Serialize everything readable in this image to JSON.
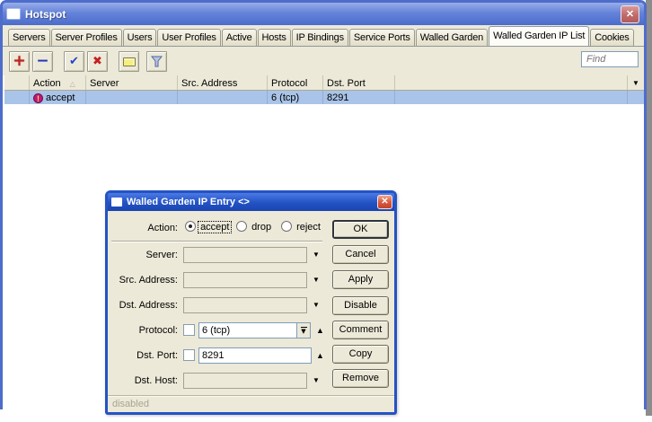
{
  "icons": {
    "close": "✕",
    "dropdown": "▼",
    "up_arrow": "▲",
    "sort_asc": "△",
    "plus": "+",
    "minus": "−",
    "check": "✔",
    "cross": "✖",
    "exclamation": "!"
  },
  "colors": {
    "titlebar_blue": "#5E7CD6",
    "dialog_blue": "#2453C4",
    "selection_blue": "#A9C4E8",
    "panel_tan": "#ECE9D8",
    "disabled_text": "#A8A490"
  },
  "window": {
    "title": "Hotspot",
    "tabs": [
      "Servers",
      "Server Profiles",
      "Users",
      "User Profiles",
      "Active",
      "Hosts",
      "IP Bindings",
      "Service Ports",
      "Walled Garden",
      "Walled Garden IP List",
      "Cookies"
    ],
    "active_tab": "Walled Garden IP List",
    "toolbar": {
      "find_placeholder": "Find"
    },
    "table": {
      "columns": [
        "Action",
        "Server",
        "Src. Address",
        "Protocol",
        "Dst. Port"
      ],
      "sort_column": "Action",
      "sort_direction": "ascending",
      "row": {
        "action": "accept",
        "server": "",
        "src_address": "",
        "protocol": "6 (tcp)",
        "dst_port": "8291",
        "state": "disabled"
      }
    }
  },
  "dialog": {
    "title": "Walled Garden IP Entry <>",
    "action_label": "Action:",
    "action_options": [
      "accept",
      "drop",
      "reject"
    ],
    "action_selected": "accept",
    "fields": {
      "server": {
        "label": "Server:",
        "value": "",
        "disabled": true
      },
      "src_address": {
        "label": "Src. Address:",
        "value": "",
        "disabled": true
      },
      "dst_address": {
        "label": "Dst. Address:",
        "value": "",
        "disabled": true
      },
      "protocol": {
        "label": "Protocol:",
        "value": "6 (tcp)",
        "checked": false
      },
      "dst_port": {
        "label": "Dst. Port:",
        "value": "8291",
        "checked": false
      },
      "dst_host": {
        "label": "Dst. Host:",
        "value": "",
        "disabled": true
      }
    },
    "buttons": [
      "OK",
      "Cancel",
      "Apply",
      "Disable",
      "Comment",
      "Copy",
      "Remove"
    ],
    "status": "disabled"
  }
}
